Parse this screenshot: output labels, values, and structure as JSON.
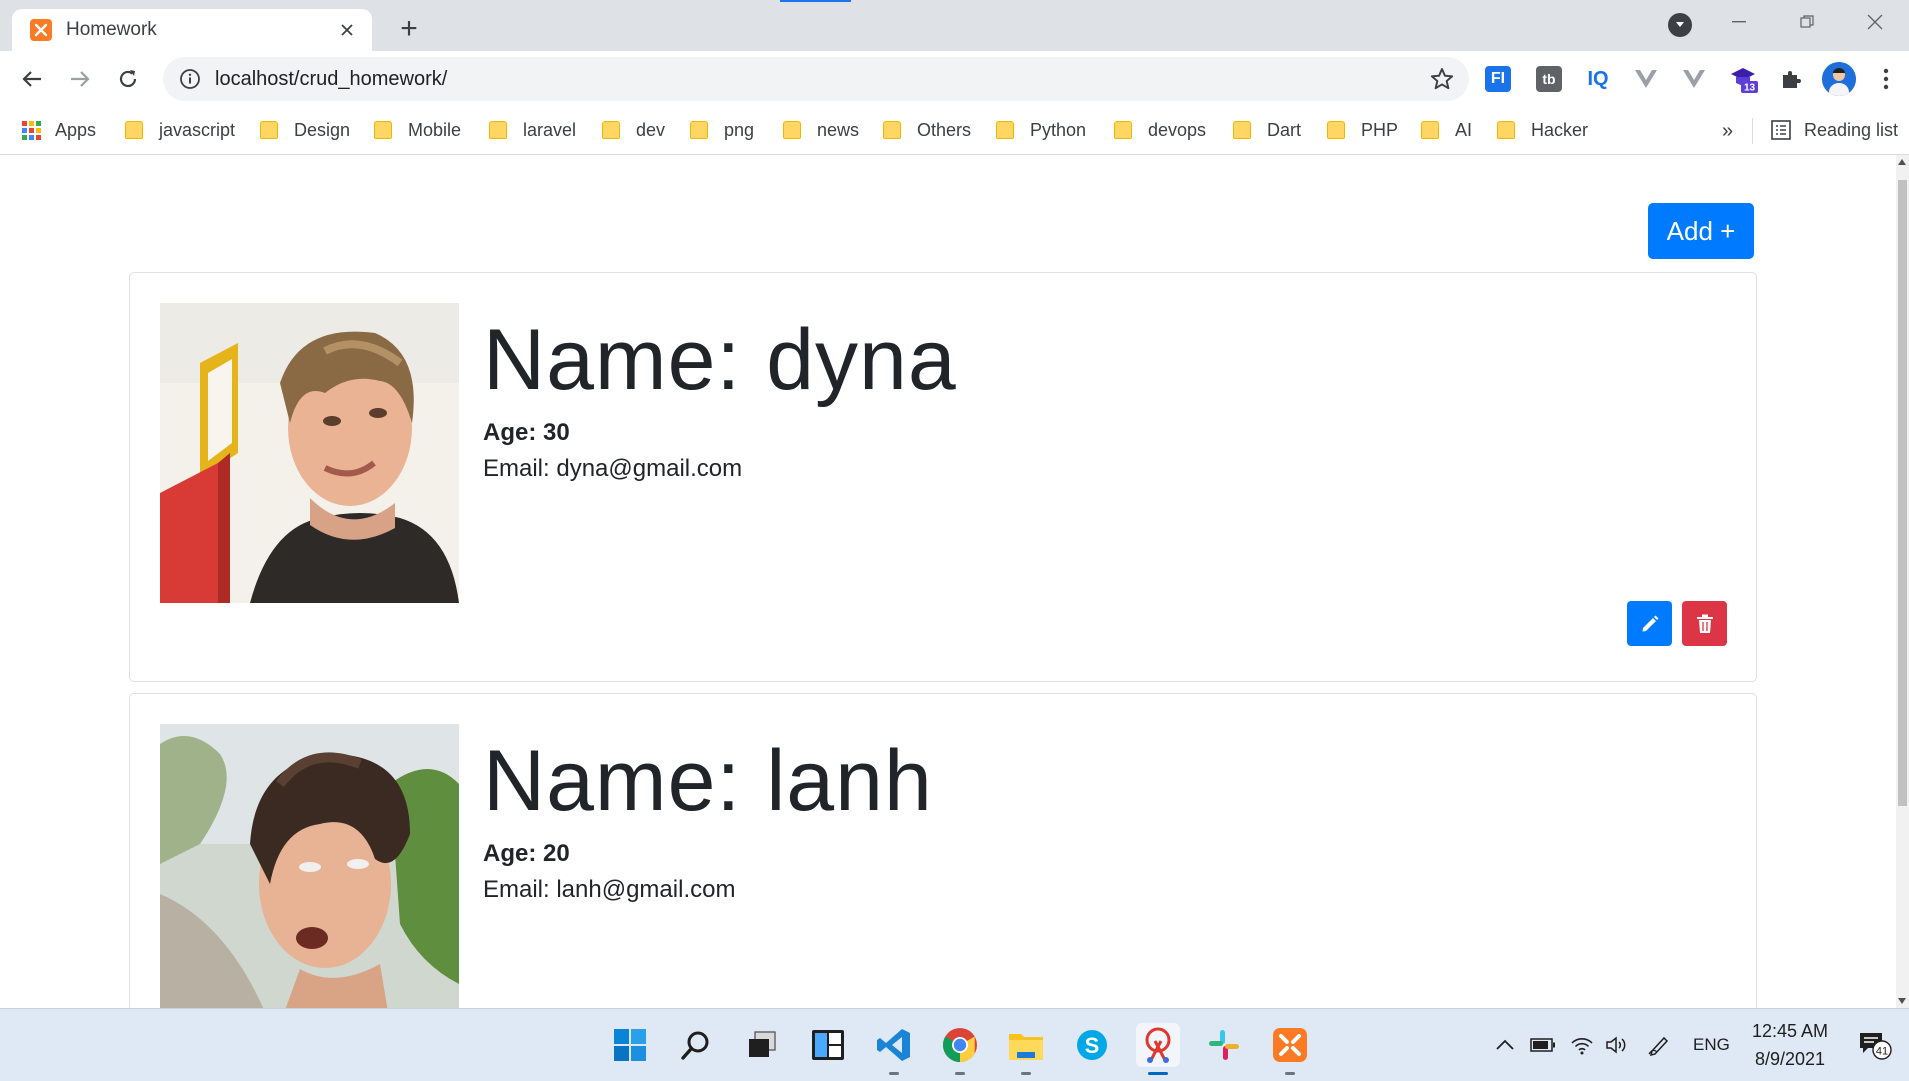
{
  "browser": {
    "tab_title": "Homework",
    "new_tab": "+",
    "url": "localhost/crud_homework/",
    "extensions": {
      "fi": "FI",
      "tb": "tb",
      "iq": "IQ",
      "badge": "13"
    },
    "bookmarks": {
      "apps": "Apps",
      "folders": [
        "javascript",
        "Design",
        "Mobile",
        "laravel",
        "dev",
        "png",
        "news",
        "Others",
        "Python",
        "devops",
        "Dart",
        "PHP",
        "AI",
        "Hacker"
      ],
      "more": "»",
      "reading_list": "Reading list"
    }
  },
  "page": {
    "add_button": "Add +",
    "cards": [
      {
        "name": "Name: dyna",
        "age": "Age: 30",
        "email": "Email: dyna@gmail.com"
      },
      {
        "name": "Name: lanh",
        "age": "Age: 20",
        "email": "Email: lanh@gmail.com"
      }
    ]
  },
  "taskbar": {
    "language": "ENG",
    "time": "12:45 AM",
    "date": "8/9/2021",
    "notifications": "41"
  },
  "colors": {
    "primary": "#007bff",
    "danger": "#dc3545",
    "xampp_orange": "#fb7a24"
  }
}
